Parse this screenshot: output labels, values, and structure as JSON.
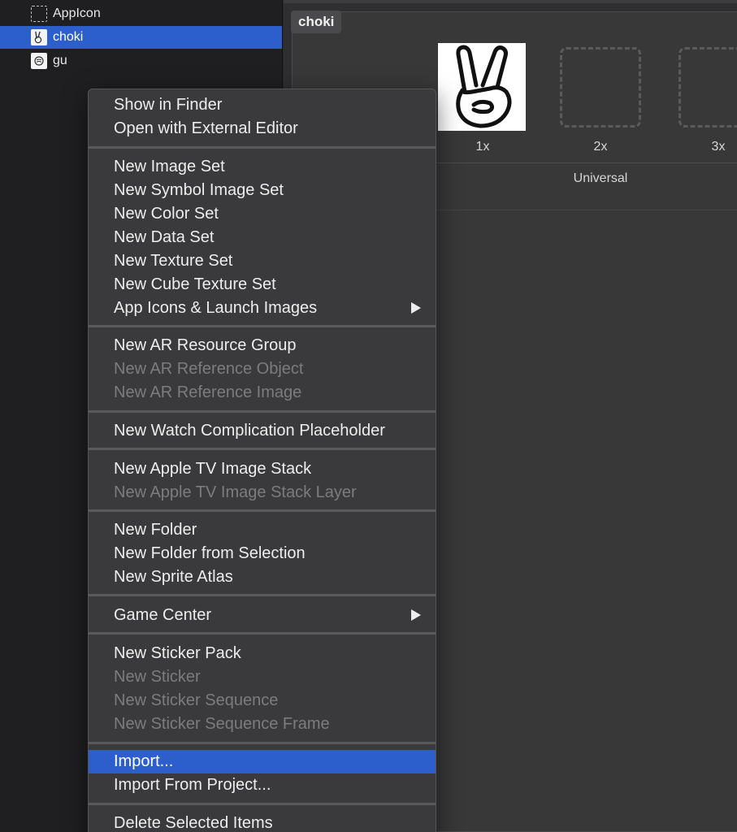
{
  "sidebar": {
    "items": [
      {
        "label": "AppIcon",
        "icon": "appicon-placeholder-icon"
      },
      {
        "label": "choki",
        "icon": "peace-hand-icon",
        "selected": true
      },
      {
        "label": "gu",
        "icon": "fist-hand-icon"
      }
    ]
  },
  "editor": {
    "set_name": "choki",
    "slots": [
      "1x",
      "2x",
      "3x"
    ],
    "idiom": "Universal"
  },
  "context_menu": {
    "groups": [
      [
        "Show in Finder",
        "Open with External Editor"
      ],
      [
        "New Image Set",
        "New Symbol Image Set",
        "New Color Set",
        "New Data Set",
        "New Texture Set",
        "New Cube Texture Set",
        "App Icons & Launch Images"
      ],
      [
        "New AR Resource Group",
        "New AR Reference Object",
        "New AR Reference Image"
      ],
      [
        "New Watch Complication Placeholder"
      ],
      [
        "New Apple TV Image Stack",
        "New Apple TV Image Stack Layer"
      ],
      [
        "New Folder",
        "New Folder from Selection",
        "New Sprite Atlas"
      ],
      [
        "Game Center"
      ],
      [
        "New Sticker Pack",
        "New Sticker",
        "New Sticker Sequence",
        "New Sticker Sequence Frame"
      ],
      [
        "Import...",
        "Import From Project..."
      ],
      [
        "Delete Selected Items"
      ]
    ],
    "disabled": [
      "New AR Reference Object",
      "New AR Reference Image",
      "New Apple TV Image Stack Layer",
      "New Sticker",
      "New Sticker Sequence",
      "New Sticker Sequence Frame"
    ],
    "has_submenu": [
      "App Icons & Launch Images",
      "Game Center"
    ],
    "highlighted": "Import..."
  },
  "colors": {
    "selection": "#2c5fcc",
    "menu_bg": "#3a3a3c",
    "disabled_text": "#7c7c7e"
  }
}
